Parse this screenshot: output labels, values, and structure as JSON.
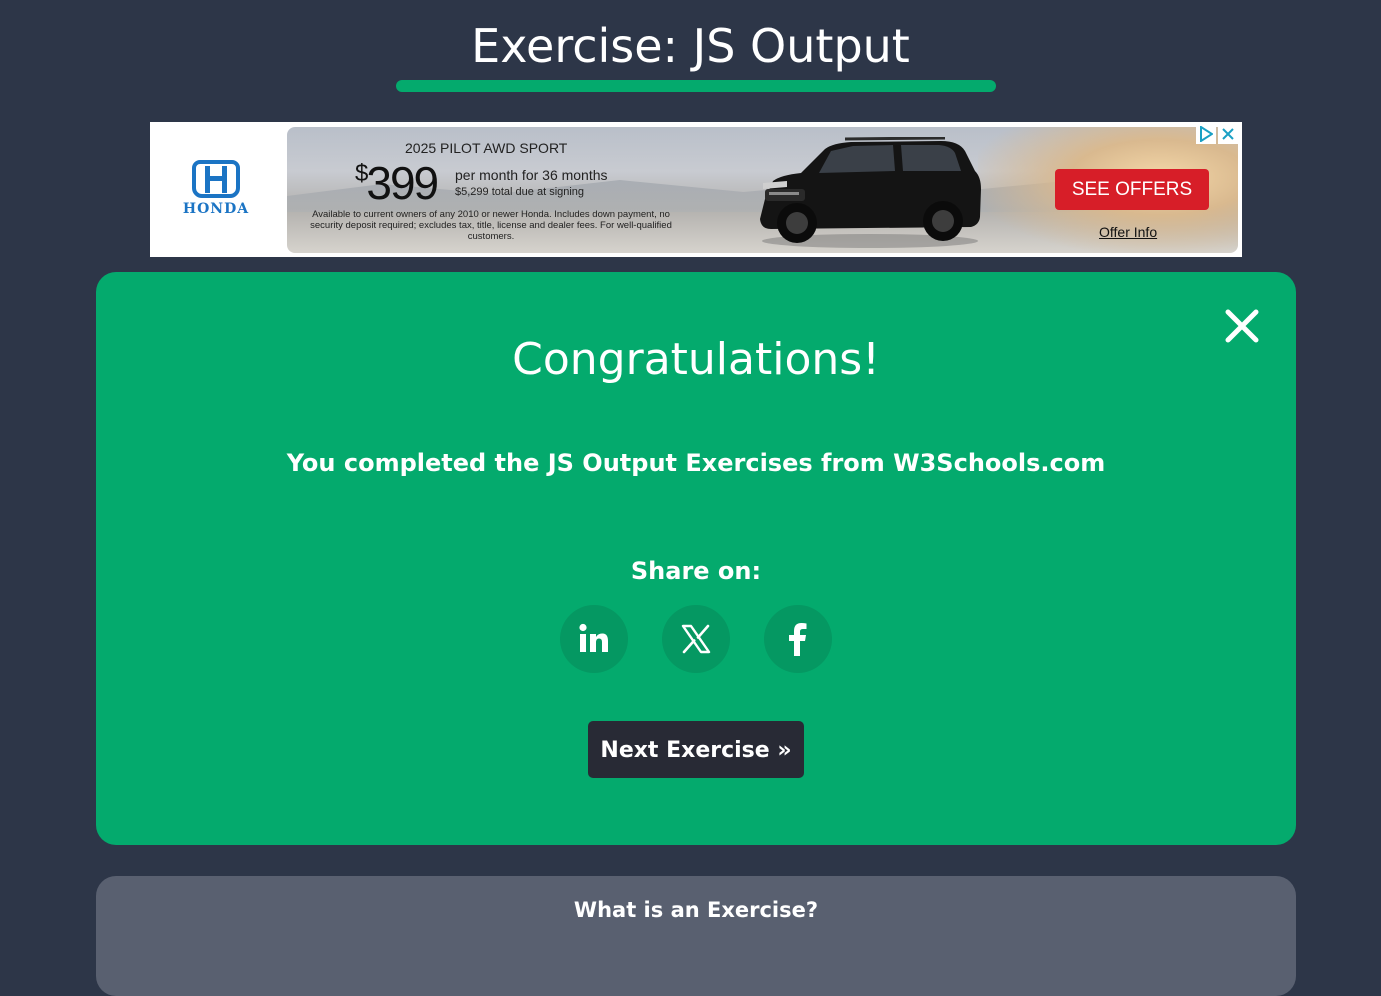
{
  "page": {
    "title": "Exercise: JS Output",
    "accent_color": "#04aa6d",
    "background_color": "#2d3648"
  },
  "ad": {
    "brand": "HONDA",
    "model": "2025 PILOT AWD SPORT",
    "price_symbol": "$",
    "price": "399",
    "term": "per month for 36 months",
    "due_at_signing": "$5,299 total due at signing",
    "fine_print": "Available to current owners of any 2010 or newer Honda. Includes down payment, no security deposit required; excludes tax, title, license and dealer fees. For well-qualified customers.",
    "cta_label": "SEE OFFERS",
    "offer_info_label": "Offer Info",
    "cta_color": "#d71e28",
    "icons": [
      "adchoices-icon",
      "close-icon"
    ]
  },
  "congrats": {
    "title": "Congratulations!",
    "message": "You completed the JS Output Exercises from W3Schools.com",
    "share_label": "Share on:",
    "share_buttons": [
      {
        "icon": "linkedin-icon"
      },
      {
        "icon": "x-icon"
      },
      {
        "icon": "facebook-icon"
      }
    ],
    "next_label": "Next Exercise »",
    "close_icon": "close-icon"
  },
  "info": {
    "title": "What is an Exercise?"
  }
}
